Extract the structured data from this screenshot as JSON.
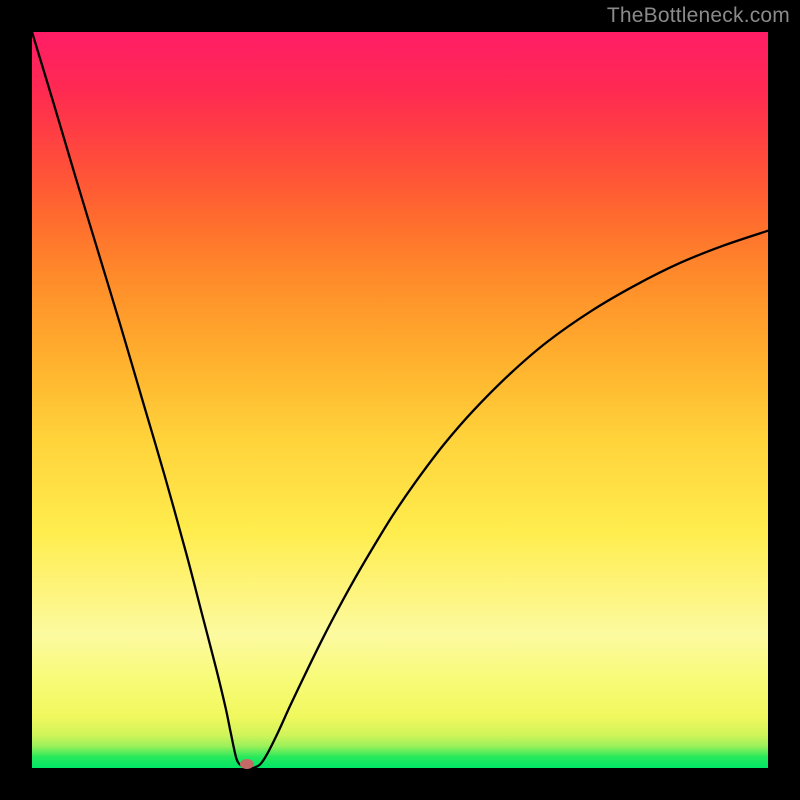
{
  "watermark": {
    "text": "TheBottleneck.com"
  },
  "chart_data": {
    "type": "line",
    "title": "",
    "xlabel": "",
    "ylabel": "",
    "xlim": [
      0,
      100
    ],
    "ylim": [
      0,
      100
    ],
    "grid": false,
    "legend": false,
    "series": [
      {
        "name": "bottleneck-curve",
        "x": [
          0,
          3,
          6,
          9,
          12,
          15,
          18,
          21,
          23,
          25,
          26.3,
          27,
          27.8,
          28.5,
          29.2,
          30,
          31,
          32,
          33.5,
          35,
          37,
          39,
          41,
          43.5,
          46,
          49,
          52,
          56,
          60,
          65,
          70,
          76,
          82,
          88,
          94,
          100
        ],
        "y": [
          100,
          90.1,
          80.0,
          70.1,
          60.2,
          50.0,
          39.8,
          29.0,
          21.3,
          13.6,
          8.2,
          4.8,
          1.2,
          0.3,
          0.0,
          0.0,
          0.5,
          2.0,
          5.0,
          8.3,
          12.5,
          16.6,
          20.5,
          25.1,
          29.4,
          34.3,
          38.7,
          44.0,
          48.6,
          53.6,
          57.9,
          62.1,
          65.6,
          68.6,
          71.0,
          73.0
        ]
      }
    ],
    "marker": {
      "x": 29.2,
      "y": 0,
      "rx": 7,
      "ry": 5
    },
    "background_gradient": {
      "direction": "vertical",
      "stops": [
        {
          "pos": 0,
          "color": "#ff1d66"
        },
        {
          "pos": 50,
          "color": "#ffd23a"
        },
        {
          "pos": 90,
          "color": "#f7fb77"
        },
        {
          "pos": 100,
          "color": "#00e566"
        }
      ]
    }
  }
}
